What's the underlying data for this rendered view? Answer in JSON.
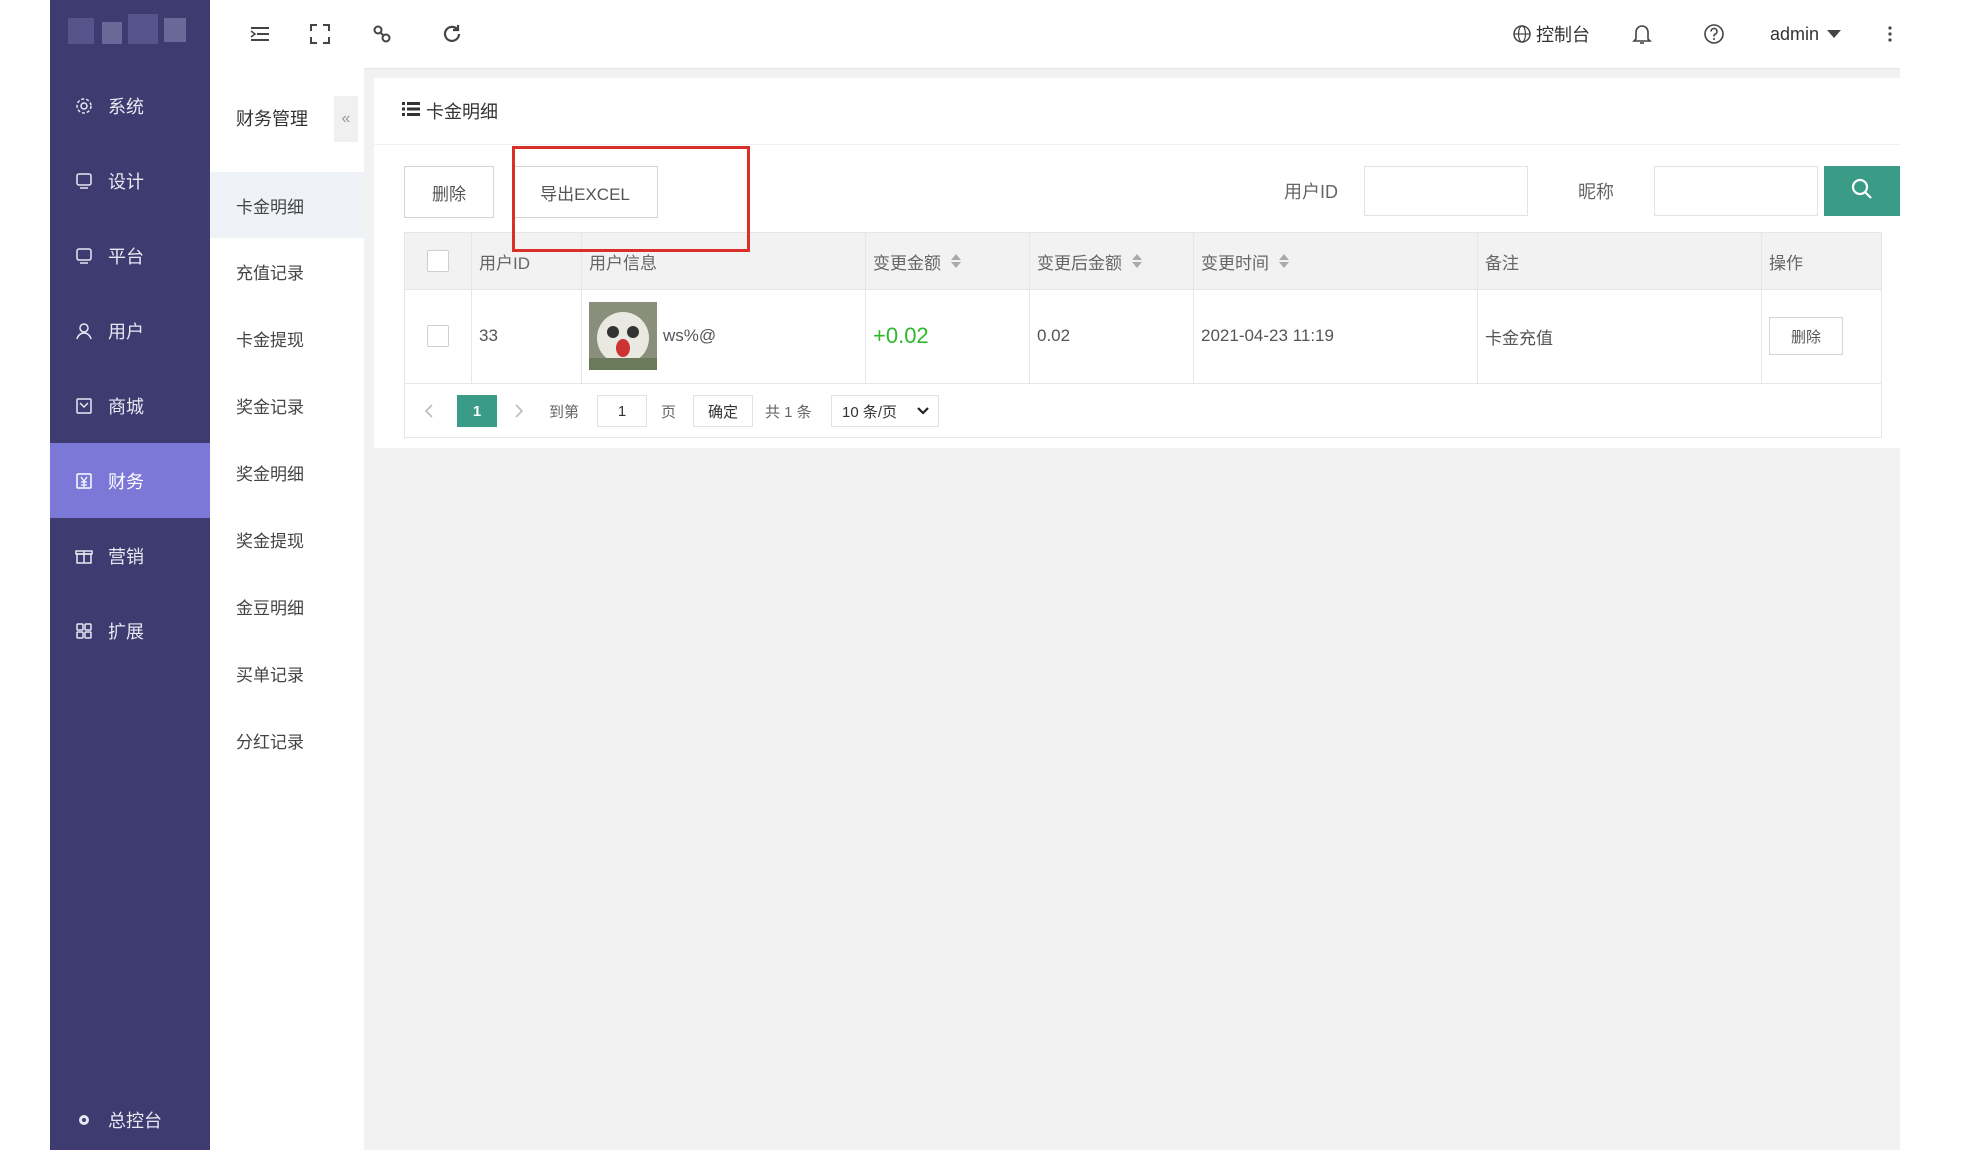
{
  "sidebar": {
    "items": [
      {
        "label": "系统",
        "icon": "gear-icon"
      },
      {
        "label": "设计",
        "icon": "monitor-icon"
      },
      {
        "label": "平台",
        "icon": "monitor-icon"
      },
      {
        "label": "用户",
        "icon": "user-icon"
      },
      {
        "label": "商城",
        "icon": "check-square-icon"
      },
      {
        "label": "财务",
        "icon": "finance-icon",
        "active": true
      },
      {
        "label": "营销",
        "icon": "gift-icon"
      },
      {
        "label": "扩展",
        "icon": "grid-icon"
      }
    ],
    "bottom": {
      "label": "总控台",
      "icon": "gear-icon"
    }
  },
  "subnav": {
    "title": "财务管理",
    "collapse": "«",
    "items": [
      {
        "label": "卡金明细",
        "active": true
      },
      {
        "label": "充值记录"
      },
      {
        "label": "卡金提现"
      },
      {
        "label": "奖金记录"
      },
      {
        "label": "奖金明细"
      },
      {
        "label": "奖金提现"
      },
      {
        "label": "金豆明细"
      },
      {
        "label": "买单记录"
      },
      {
        "label": "分红记录"
      }
    ]
  },
  "topbar": {
    "console": "控制台",
    "user": "admin"
  },
  "page": {
    "title": "卡金明细"
  },
  "toolbar": {
    "delete_label": "删除",
    "export_label": "导出EXCEL",
    "userid_label": "用户ID",
    "nickname_label": "昵称"
  },
  "table": {
    "columns": [
      "用户ID",
      "用户信息",
      "变更金额",
      "变更后金额",
      "变更时间",
      "备注",
      "操作"
    ],
    "rows": [
      {
        "user_id": "33",
        "nickname": "ws%@",
        "amount": "+0.02",
        "after": "0.02",
        "time": "2021-04-23 11:19",
        "note": "卡金充值",
        "action": "删除"
      }
    ]
  },
  "pager": {
    "current": "1",
    "goto_label": "到第",
    "goto_value": "1",
    "page_unit": "页",
    "confirm": "确定",
    "total": "共 1 条",
    "page_size": "10 条/页"
  },
  "colors": {
    "sidebar": "#3e3b70",
    "sidebar_active": "#7c78d8",
    "accent": "#3a9b87",
    "positive": "#2eb82e",
    "highlight": "#d9302a"
  }
}
